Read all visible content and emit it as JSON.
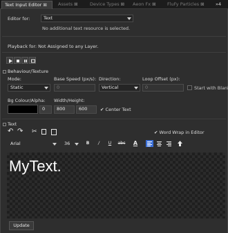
{
  "tabs": [
    {
      "label": "Text Input Editor",
      "active": true
    },
    {
      "label": "Assets",
      "active": false
    },
    {
      "label": "Device Types",
      "active": false
    },
    {
      "label": "Aeon Fx",
      "active": false
    },
    {
      "label": "FluFy Particles",
      "active": false
    }
  ],
  "tab_overflow": "4",
  "editor_for": {
    "label": "Editor for:",
    "value": "Text",
    "note": "No additional text resource is selected."
  },
  "playback": {
    "label": "Playback for: Not Assigned to any Layer."
  },
  "behaviour": {
    "header": "Behaviour/Texture",
    "mode_label": "Mode:",
    "mode_value": "Static",
    "base_speed_label": "Base Speed (px/s):",
    "base_speed_value": "0",
    "direction_label": "Direction:",
    "direction_value": "Vertical",
    "loop_offset_label": "Loop Offset (px):",
    "loop_offset_value": "0",
    "start_blank_label": "Start with Blank",
    "bg_label": "Bg Colour/Alpha:",
    "bg_alpha_value": "0",
    "wh_label": "Width/Height:",
    "width_value": "800",
    "height_value": "600",
    "center_text_label": "Center Text",
    "center_text_checked": true
  },
  "text_section": {
    "header": "Text",
    "word_wrap_label": "Word Wrap in Editor",
    "word_wrap_checked": true,
    "font_value": "Arial",
    "size_value": "36",
    "bold": "B",
    "italic": "/",
    "underline": "U",
    "strike": "abc",
    "color_a": "A",
    "content": "MyText."
  },
  "update_button": "Update",
  "colors": {
    "accent": "#3a6fd8",
    "bg_color_swatch": "#000000"
  }
}
